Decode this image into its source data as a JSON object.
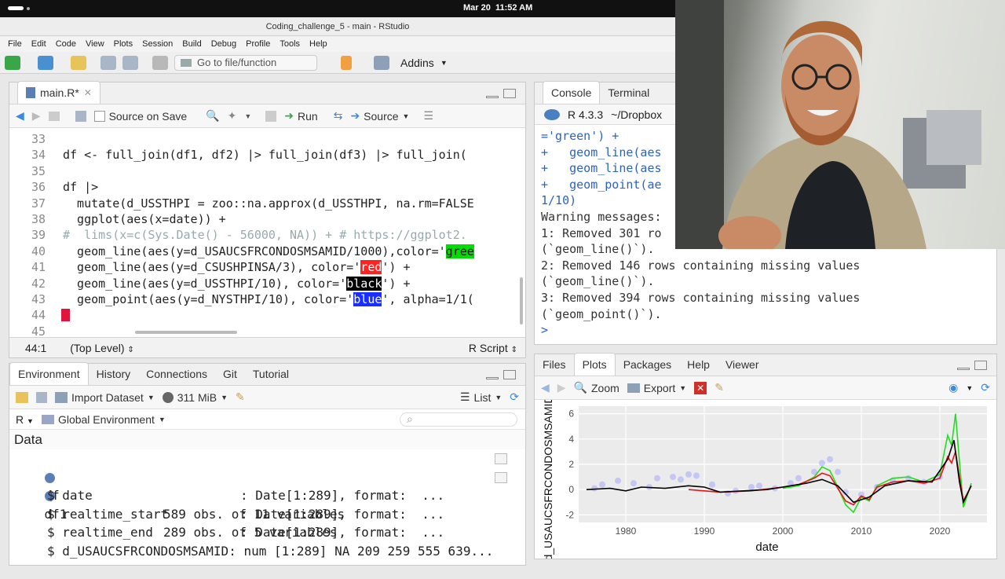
{
  "os": {
    "datetime": "Mar 20  11:52 AM"
  },
  "window": {
    "title": "Coding_challenge_5 - main - RStudio"
  },
  "menu": [
    "File",
    "Edit",
    "Code",
    "View",
    "Plots",
    "Session",
    "Build",
    "Debug",
    "Profile",
    "Tools",
    "Help"
  ],
  "toolbar": {
    "goto_placeholder": "Go to file/function",
    "addins": "Addins"
  },
  "editor": {
    "tab": "main.R*",
    "source_on_save": "Source on Save",
    "run": "Run",
    "source": "Source",
    "status_pos": "44:1",
    "status_scope": "(Top Level)",
    "status_type": "R Script",
    "lines": [
      {
        "n": "33",
        "text": ""
      },
      {
        "n": "34",
        "text": "df <- full_join(df1, df2) |> full_join(df3) |> full_join("
      },
      {
        "n": "35",
        "text": ""
      },
      {
        "n": "36",
        "text": "df |>"
      },
      {
        "n": "37",
        "text": "  mutate(d_USSTHPI = zoo::na.approx(d_USSTHPI, na.rm=FALSE"
      },
      {
        "n": "38",
        "text": "  ggplot(aes(x=date)) +"
      },
      {
        "n": "39",
        "text": "#  lims(x=c(Sys.Date() - 56000, NA)) + # https://ggplot2."
      },
      {
        "n": "40",
        "text": "  geom_line(aes(y=d_USAUCSFRCONDOSMSAMID/1000),color='"
      },
      {
        "n": "41",
        "text": "  geom_line(aes(y=d_CSUSHPINSA/3), color='"
      },
      {
        "n": "42",
        "text": "  geom_line(aes(y=d_USSTHPI/10), color='"
      },
      {
        "n": "43",
        "text": "  geom_point(aes(y=d_NYSTHPI/10), color='"
      },
      {
        "n": "44",
        "text": ""
      },
      {
        "n": "45",
        "text": ""
      }
    ],
    "hl": {
      "green": "gree",
      "red": "red",
      "black": "black",
      "blue": "blue"
    },
    "tails": {
      "l41": "') +",
      "l42": "') +",
      "l43": "', alpha=1/1("
    }
  },
  "console": {
    "tabs": [
      "Console",
      "Terminal"
    ],
    "r_version": "R 4.3.3",
    "path": "~/Dropbox",
    "lines": [
      "='green') +",
      "+   geom_line(aes",
      "+   geom_line(aes",
      "+   geom_point(ae",
      "1/10)",
      "Warning messages:",
      "1: Removed 301 ro",
      "(`geom_line()`).",
      "2: Removed 146 rows containing missing values",
      "(`geom_line()`).",
      "3: Removed 394 rows containing missing values",
      "(`geom_point()`).",
      "> "
    ]
  },
  "env": {
    "tabs": [
      "Environment",
      "History",
      "Connections",
      "Git",
      "Tutorial"
    ],
    "import_dataset": "Import Dataset",
    "memory": "311 MiB",
    "view": "List",
    "lang": "R",
    "scope": "Global Environment",
    "section": "Data",
    "rows": [
      {
        "name": "df",
        "value": "589 obs. of 11 variables"
      },
      {
        "name": "df1",
        "value": "289 obs. of 5 variables"
      }
    ],
    "fields": [
      {
        "name": "$ date",
        "value": ": Date[1:289], format:  ..."
      },
      {
        "name": "$ realtime_start",
        "value": ": Date[1:289], format:  ..."
      },
      {
        "name": "$ realtime_end",
        "value": ": Date[1:289], format:  ..."
      },
      {
        "name": "$ d_USAUCSFRCONDOSMSAMID:",
        "value": "num [1:289] NA 209 259 555 639..."
      }
    ]
  },
  "plots": {
    "tabs": [
      "Files",
      "Plots",
      "Packages",
      "Help",
      "Viewer"
    ],
    "zoom": "Zoom",
    "export": "Export",
    "colors": {
      "green": "#22dd22",
      "red": "#ee1111",
      "black": "#000000",
      "blue": "#9999ff"
    }
  },
  "chart_data": {
    "type": "line",
    "xlabel": "date",
    "ylabel": "d_USAUCSFRCONDOSMSAMID/1000",
    "x_ticks": [
      "1980",
      "1990",
      "2000",
      "2010",
      "2020"
    ],
    "y_ticks": [
      "6",
      "4",
      "2",
      "0",
      "-2"
    ],
    "xlim": [
      1974,
      2026
    ],
    "ylim": [
      -2.6,
      6.6
    ],
    "series": [
      {
        "color": "green",
        "x": [
          2000,
          2002,
          2004,
          2005,
          2006,
          2007,
          2008,
          2009,
          2010,
          2011,
          2012,
          2014,
          2016,
          2018,
          2020,
          2021,
          2021.5,
          2022,
          2022.5,
          2023,
          2024
        ],
        "y": [
          0.1,
          0.3,
          1.0,
          1.8,
          1.5,
          0.2,
          -1.2,
          -1.8,
          -0.6,
          -0.9,
          0.3,
          0.9,
          1.0,
          0.6,
          1.2,
          4.3,
          3.5,
          6.0,
          2.2,
          -1.4,
          0.5
        ]
      },
      {
        "color": "red",
        "x": [
          1988,
          1992,
          1996,
          2000,
          2002,
          2004,
          2005,
          2006,
          2007,
          2008,
          2009,
          2010,
          2011,
          2012,
          2014,
          2016,
          2018,
          2020,
          2021,
          2021.5,
          2022,
          2022.5,
          2023,
          2024
        ],
        "y": [
          0.0,
          -0.2,
          -0.1,
          0.2,
          0.4,
          0.9,
          1.3,
          1.1,
          0.1,
          -0.9,
          -1.2,
          -0.5,
          -0.8,
          0.2,
          0.6,
          0.7,
          0.5,
          0.9,
          2.6,
          2.1,
          3.0,
          1.0,
          -0.9,
          0.3
        ]
      },
      {
        "color": "black",
        "x": [
          1975,
          1978,
          1980,
          1982,
          1985,
          1988,
          1990,
          1992,
          1995,
          1998,
          2000,
          2003,
          2005,
          2007,
          2009,
          2011,
          2013,
          2016,
          2019,
          2021,
          2021.8,
          2022.5,
          2023,
          2024
        ],
        "y": [
          0.0,
          0.1,
          -0.1,
          0.2,
          0.1,
          0.3,
          0.2,
          -0.2,
          -0.1,
          0.0,
          0.2,
          0.5,
          0.8,
          0.3,
          -1.0,
          -0.6,
          0.3,
          0.7,
          0.6,
          2.4,
          3.9,
          0.6,
          -1.0,
          0.3
        ]
      }
    ],
    "points": {
      "color": "blue",
      "x": [
        1976,
        1977,
        1979,
        1981,
        1983,
        1984,
        1986,
        1987,
        1988,
        1989,
        1991,
        1993,
        1994,
        1996,
        1997,
        1999,
        2001,
        2002,
        2004,
        2005,
        2006,
        2007,
        2008,
        2010,
        2012,
        2014,
        2016,
        2018,
        2020
      ],
      "y": [
        0.1,
        0.4,
        0.7,
        0.5,
        0.2,
        0.9,
        1.0,
        0.8,
        1.2,
        1.1,
        0.4,
        -0.3,
        -0.1,
        0.2,
        0.3,
        0.1,
        0.5,
        0.9,
        1.4,
        2.1,
        2.4,
        1.4,
        -0.2,
        -0.4,
        0.2,
        0.7,
        0.9,
        0.6,
        1.0
      ]
    }
  }
}
